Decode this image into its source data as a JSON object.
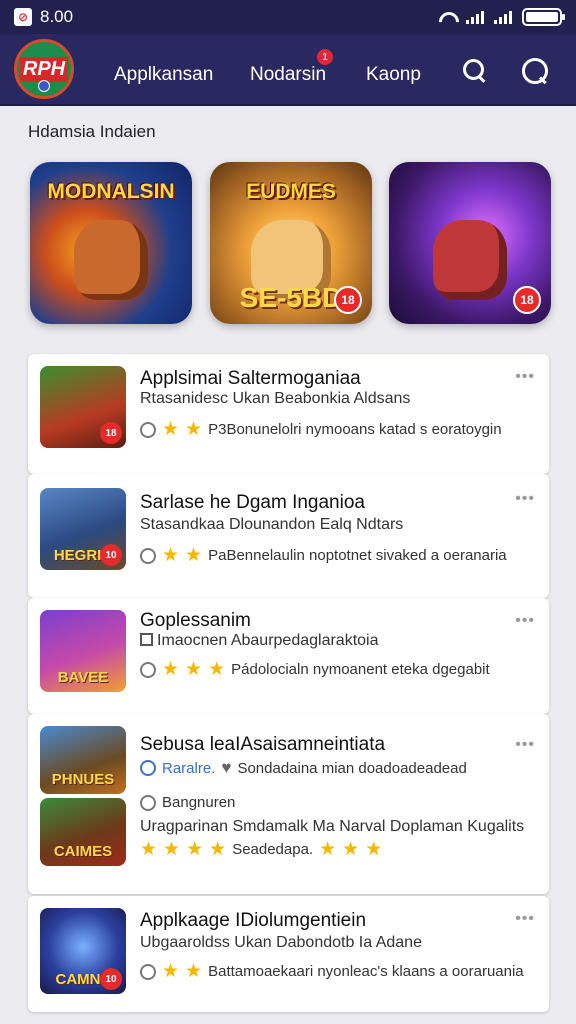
{
  "status_bar": {
    "time": "8.00",
    "app_icon": "app-notification-icon"
  },
  "header": {
    "logo_text": "RPH",
    "nav": [
      "Applkansan",
      "Nodarsin",
      "Kaonp"
    ],
    "notification_count": "1",
    "icons": [
      "search-icon",
      "profile-search-icon"
    ]
  },
  "section": {
    "title": "Hdamsia Indaien"
  },
  "featured": [
    {
      "title": "MODNALSIN",
      "sub": "",
      "badge": ""
    },
    {
      "title": "EUDMES",
      "sub": "SE-5BD",
      "badge": "18"
    },
    {
      "title": "",
      "sub": "",
      "badge": "18"
    }
  ],
  "apps": [
    {
      "title": "Applsimai Saltermoganiaa",
      "subtitle": "Rtasanidesc Ukan Beabonkia Aldsans",
      "meta": "P3Bonunelolri nymooans katad s eoratoygin",
      "stars": 2,
      "badge": "18",
      "thumb_text": ""
    },
    {
      "title": "Sarlase he Dgam Inganioa",
      "subtitle": "Stasandkaa Dlounandon Ealq Ndtars",
      "meta": "PaBennelaulin noptotnet sivaked a oeranaria",
      "stars": 2,
      "badge": "10",
      "thumb_text": "HEGRID"
    },
    {
      "title": "Goplessanim",
      "subtitle": "Imaocnen Abaurpedaglaraktoia",
      "meta": "Pádolocialn nymoanent eteka dgegabit",
      "stars": 3,
      "badge": "",
      "thumb_text": "BAVEE"
    },
    {
      "title": "Sebusa leaIAsaisamneintiata",
      "subtitle": "Raralre.",
      "subtitle2": "Sondadaina mian doadoadeadead",
      "secondary": "Bangnuren",
      "desc": "Uragparinan Smdamalk Ma Narval Doplaman Kugalits",
      "meta": "Seadedapa.",
      "stars": 4,
      "stars2": 3,
      "thumb_text": "PHNUES",
      "thumb_text2": "CAIMES"
    },
    {
      "title": "Applkaage IDiolumgentiein",
      "subtitle": "Ubgaaroldss Ukan Dabondotb Ia Adane",
      "meta": "Battamoaekaari nyonleac's klaans a ooraruania",
      "stars": 2,
      "badge": "10",
      "thumb_text": "CAMNE"
    }
  ],
  "more_label": "•••"
}
